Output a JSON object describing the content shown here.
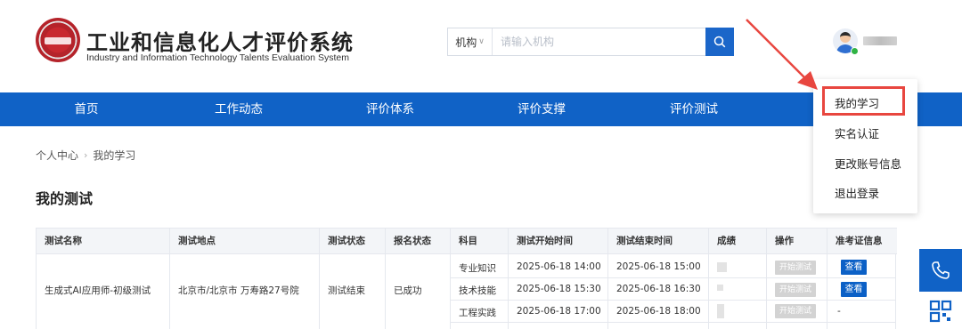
{
  "header": {
    "title": "工业和信息化人才评价系统",
    "subtitle": "Industry and Information Technology Talents Evaluation System",
    "search": {
      "select_label": "机构",
      "placeholder": "请输入机构"
    }
  },
  "nav": {
    "items": [
      "首页",
      "工作动态",
      "评价体系",
      "评价支撑",
      "评价测试"
    ]
  },
  "dropdown": {
    "items": [
      "我的学习",
      "实名认证",
      "更改账号信息",
      "退出登录"
    ]
  },
  "breadcrumb": {
    "home": "个人中心",
    "current": "我的学习"
  },
  "section": {
    "title": "我的测试"
  },
  "table": {
    "headers": [
      "测试名称",
      "测试地点",
      "测试状态",
      "报名状态",
      "科目",
      "测试开始时间",
      "测试结束时间",
      "成绩",
      "操作",
      "准考证信息"
    ],
    "exam": {
      "name": "生成式AI应用师-初级测试",
      "location": "北京市/北京市 万寿路27号院",
      "test_status": "测试结束",
      "signup_status": "已成功"
    },
    "subjects": [
      {
        "subject": "专业知识",
        "start": "2025-06-18 14:00",
        "end": "2025-06-18 15:00",
        "action": "开始测试",
        "ticket": "查看"
      },
      {
        "subject": "技术技能",
        "start": "2025-06-18 15:30",
        "end": "2025-06-18 16:30",
        "action": "开始测试",
        "ticket": "查看"
      },
      {
        "subject": "工程实践",
        "start": "2025-06-18 17:00",
        "end": "2025-06-18 18:00",
        "action": "开始测试",
        "ticket": "-"
      }
    ]
  },
  "colors": {
    "primary": "#1062c6",
    "highlight": "#e8463f",
    "badge": "#2fb344"
  },
  "icons": {
    "search": "search-icon",
    "phone": "phone-icon",
    "qr": "qr-code-icon",
    "chevron": "chevron-down-icon"
  }
}
